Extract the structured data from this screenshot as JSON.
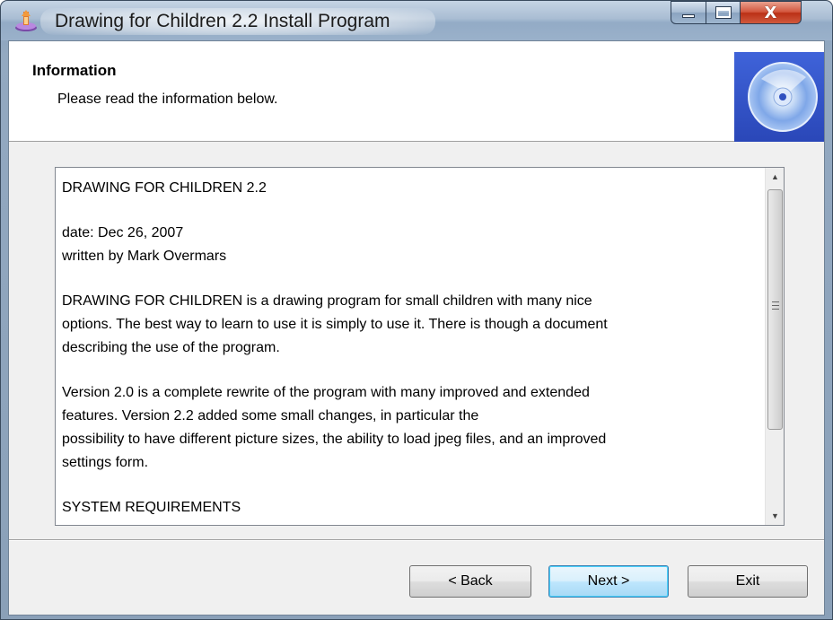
{
  "window": {
    "title": "Drawing for Children 2.2 Install Program",
    "icon": "installer-icon",
    "caption_buttons": {
      "minimize_icon": "minimize-icon",
      "maximize_icon": "maximize-icon",
      "close_glyph": "X"
    }
  },
  "header": {
    "title": "Information",
    "subtitle": "Please read the information below.",
    "logo_icon": "cd-disc-icon"
  },
  "info_text": {
    "lines": [
      " DRAWING FOR CHILDREN 2.2",
      "date: Dec 26, 2007",
      "written by Mark Overmars",
      "DRAWING FOR CHILDREN is a drawing program for small children with many nice",
      "options. The best way to learn to use it is simply to use it. There is though a document",
      "describing the use of the program.",
      "Version 2.0 is a complete rewrite of the program with many improved and extended",
      "features. Version 2.2 added some small changes, in particular the",
      "possibility to have different picture sizes, the ability to load jpeg files, and an improved",
      "settings form.",
      "SYSTEM REQUIREMENTS"
    ]
  },
  "buttons": {
    "back": "< Back",
    "next": "Next >",
    "exit": "Exit"
  },
  "colors": {
    "title_bar": "#a9bdd3",
    "close_button": "#c9442a",
    "client_background": "#f0f0f0",
    "default_button_border": "#3c7fb1"
  }
}
